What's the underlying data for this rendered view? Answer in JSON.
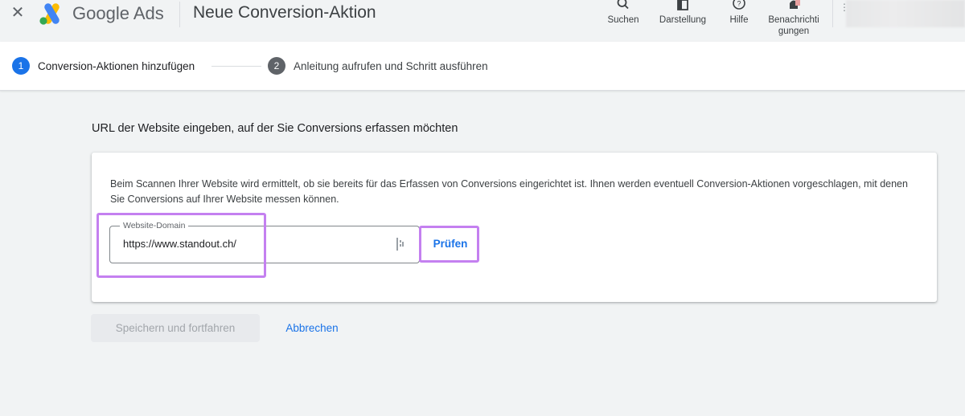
{
  "header": {
    "close_glyph": "✕",
    "brand_google": "Google",
    "brand_ads": "Ads",
    "title": "Neue Conversion-Aktion",
    "tools": {
      "search": "Suchen",
      "view": "Darstellung",
      "help": "Hilfe",
      "notifications": "Benachrichti\ngungen"
    },
    "icons": [
      "close-icon",
      "google-ads-logo",
      "search-icon",
      "view-icon",
      "help-icon",
      "bell-icon"
    ]
  },
  "stepper": {
    "steps": [
      {
        "number": "1",
        "label": "Conversion-Aktionen hinzufügen",
        "state": "active"
      },
      {
        "number": "2",
        "label": "Anleitung aufrufen und Schritt ausführen",
        "state": "pending"
      }
    ]
  },
  "main": {
    "section_title": "URL der Website eingeben, auf der Sie Conversions erfassen möchten",
    "description": "Beim Scannen Ihrer Website wird ermittelt, ob sie bereits für das Erfassen von Conversions eingerichtet ist. Ihnen werden eventuell Conversion-Aktionen vorgeschlagen, mit denen Sie Conversions auf Ihrer Website messen können.",
    "domain_field": {
      "label": "Website-Domain",
      "value": "https://www.standout.ch/"
    },
    "check_button": "Prüfen",
    "save_button": "Speichern und fortfahren",
    "cancel_button": "Abbrechen"
  },
  "colors": {
    "accent": "#1a73e8",
    "highlight": "#c480f0",
    "step_pending": "#5f6368",
    "background": "#f1f3f4"
  }
}
